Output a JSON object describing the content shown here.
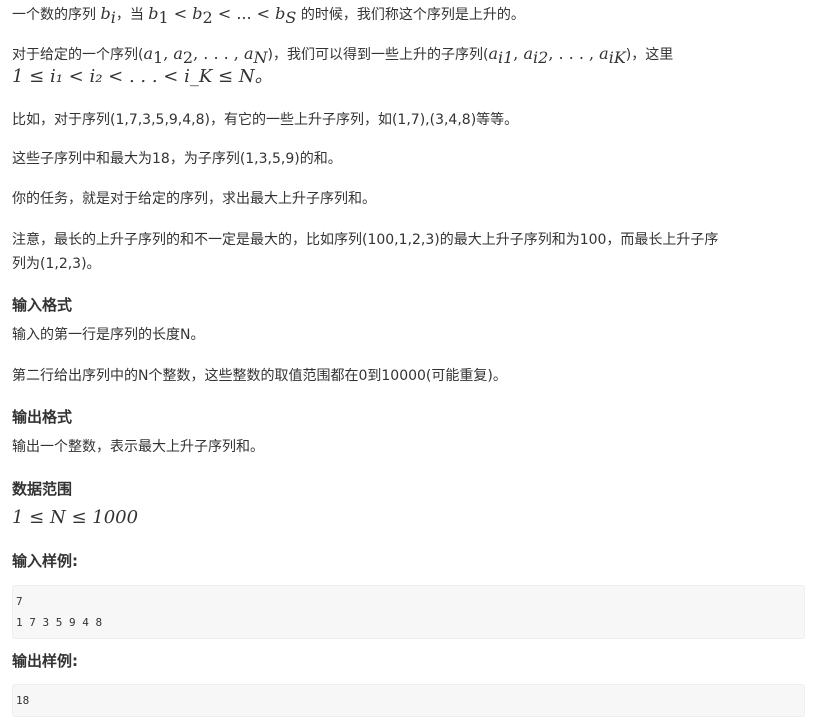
{
  "intro": {
    "line1_a": "一个数的序列 ",
    "line1_b": "b",
    "line1_b_sub": "i",
    "line1_c": "，当 ",
    "line1_math": "b",
    "line1_math_sub1": "1",
    "line1_lt1": " < ",
    "line1_math2": "b",
    "line1_math_sub2": "2",
    "line1_lt2": " < ... < ",
    "line1_math3": "b",
    "line1_math_sub3": "S",
    "line1_d": " 的时候，我们称这个序列是上升的。"
  },
  "given": {
    "text_a": "对于给定的一个序列(",
    "math_a": "a",
    "sub_a1": "1",
    "comma1": ", ",
    "math_a2": "a",
    "sub_a2": "2",
    "ellipsis": ", . . . , ",
    "math_aN": "a",
    "sub_aN": "N",
    "text_b": ")，我们可以得到一些上升的子序列(",
    "math_ai": "a",
    "sub_ai1": "i1",
    "comma2": ", ",
    "math_ai2": "a",
    "sub_ai2": "i2",
    "ellipsis2": ", . . . , ",
    "math_aiK": "a",
    "sub_aiK": "iK",
    "text_c": ")，这里",
    "line2": "1 ≤ i₁ < i₂ < . . . < i_K ≤ N。"
  },
  "para_example": "比如，对于序列(1,7,3,5,9,4,8)，有它的一些上升子序列，如(1,7),(3,4,8)等等。",
  "para_max": "这些子序列中和最大为18，为子序列(1,3,5,9)的和。",
  "para_task": "你的任务，就是对于给定的序列，求出最大上升子序列和。",
  "para_note_1": "注意，最长的上升子序列的和不一定是最大的，比如序列(100,1,2,3)的最大上升子序列和为100，而最长上升子序",
  "para_note_2": "列为(1,2,3)。",
  "input_format": {
    "heading": "输入格式",
    "line1": "输入的第一行是序列的长度N。",
    "line2": "第二行给出序列中的N个整数，这些整数的取值范围都在0到10000(可能重复)。"
  },
  "output_format": {
    "heading": "输出格式",
    "line1": "输出一个整数，表示最大上升子序列和。"
  },
  "data_range": {
    "heading": "数据范围",
    "math": "1 ≤ N ≤ 1000"
  },
  "sample_input": {
    "heading": "输入样例:",
    "line1": "7",
    "line2": "1 7 3 5 9 4 8"
  },
  "sample_output": {
    "heading": "输出样例:",
    "line1": "18"
  }
}
